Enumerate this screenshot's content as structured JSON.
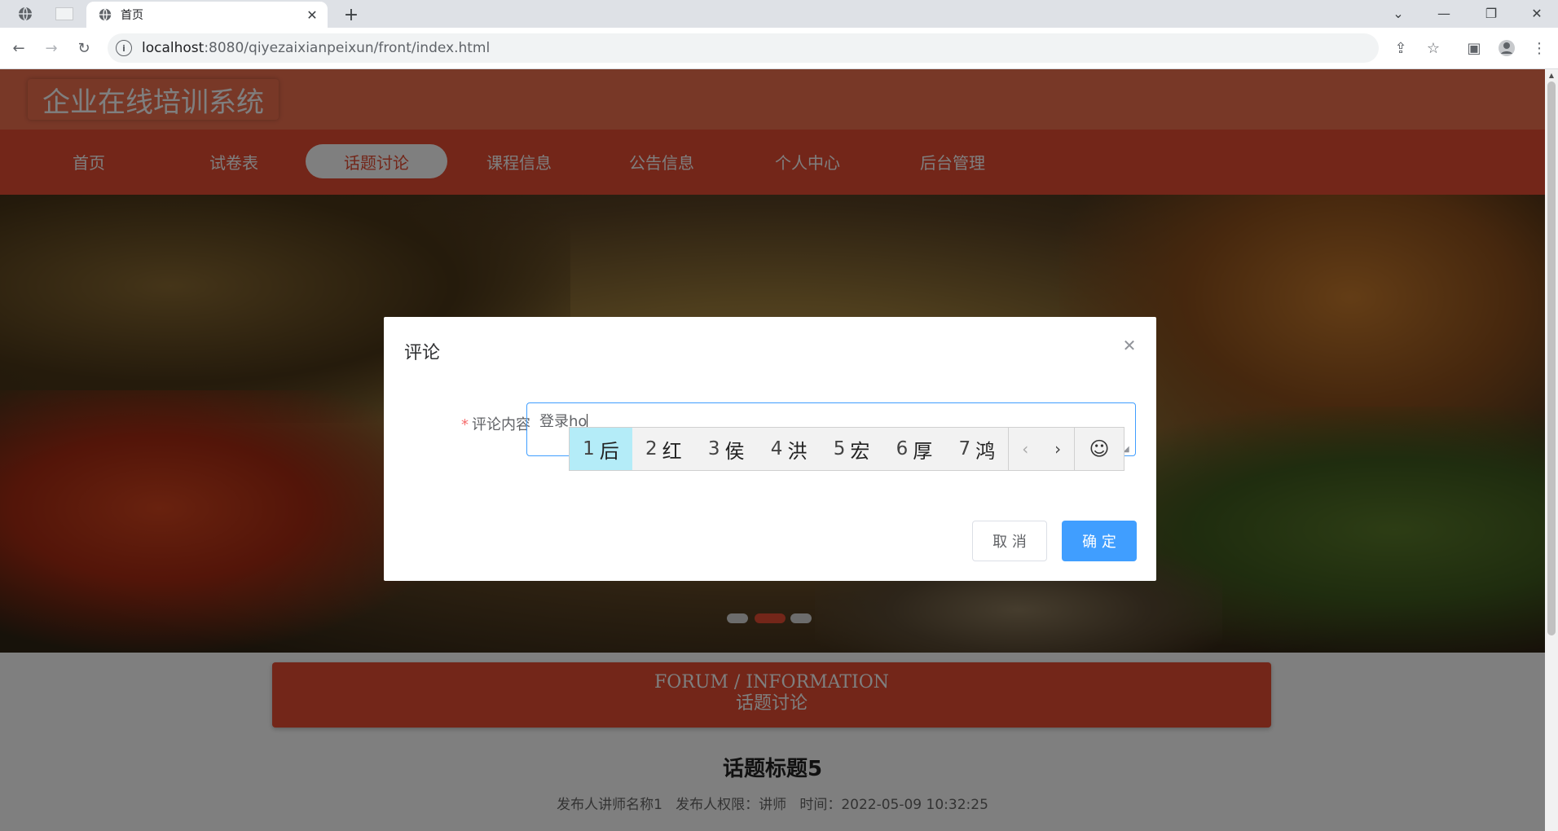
{
  "browser": {
    "tab_title": "首页",
    "new_tab": "+",
    "url_host": "localhost",
    "url_path": ":8080/qiyezaixianpeixun/front/index.html"
  },
  "site": {
    "logo": "企业在线培训系统",
    "nav": [
      {
        "label": "首页"
      },
      {
        "label": "试卷表"
      },
      {
        "label": "话题讨论"
      },
      {
        "label": "课程信息"
      },
      {
        "label": "公告信息"
      },
      {
        "label": "个人中心"
      },
      {
        "label": "后台管理"
      }
    ],
    "active_nav": "话题讨论"
  },
  "section": {
    "en_title": "FORUM / INFORMATION",
    "cn_title": "话题讨论"
  },
  "topic": {
    "title": "话题标题5",
    "meta": "发布人讲师名称1   发布人权限：讲师   时间：2022-05-09 10:32:25"
  },
  "dialog": {
    "title": "评论",
    "required_mark": "*",
    "field_label": "评论内容",
    "field_value": "登录ho",
    "cancel_label": "取 消",
    "confirm_label": "确 定"
  },
  "ime": {
    "candidates": [
      {
        "num": "1",
        "char": "后"
      },
      {
        "num": "2",
        "char": "红"
      },
      {
        "num": "3",
        "char": "侯"
      },
      {
        "num": "4",
        "char": "洪"
      },
      {
        "num": "5",
        "char": "宏"
      },
      {
        "num": "6",
        "char": "厚"
      },
      {
        "num": "7",
        "char": "鸿"
      }
    ],
    "selected_index": 0
  },
  "colors": {
    "header": "#f0704f",
    "nav": "#e64c32",
    "primary": "#409eff",
    "ime_highlight": "#b4ecf8"
  }
}
